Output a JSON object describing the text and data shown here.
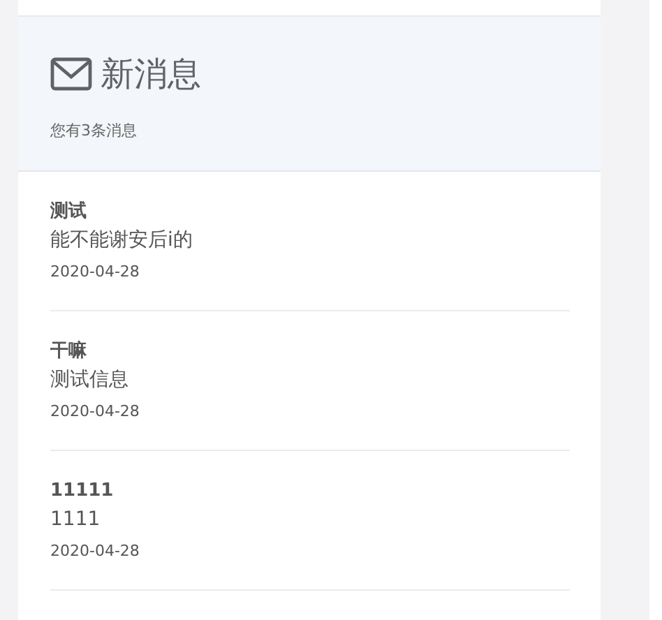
{
  "header": {
    "title": "新消息",
    "subtitle": "您有3条消息"
  },
  "messages": [
    {
      "title": "测试",
      "content": "能不能谢安后i的",
      "date": "2020-04-28"
    },
    {
      "title": "干嘛",
      "content": "测试信息",
      "date": "2020-04-28"
    },
    {
      "title": "11111",
      "content": "1111",
      "date": "2020-04-28"
    }
  ]
}
